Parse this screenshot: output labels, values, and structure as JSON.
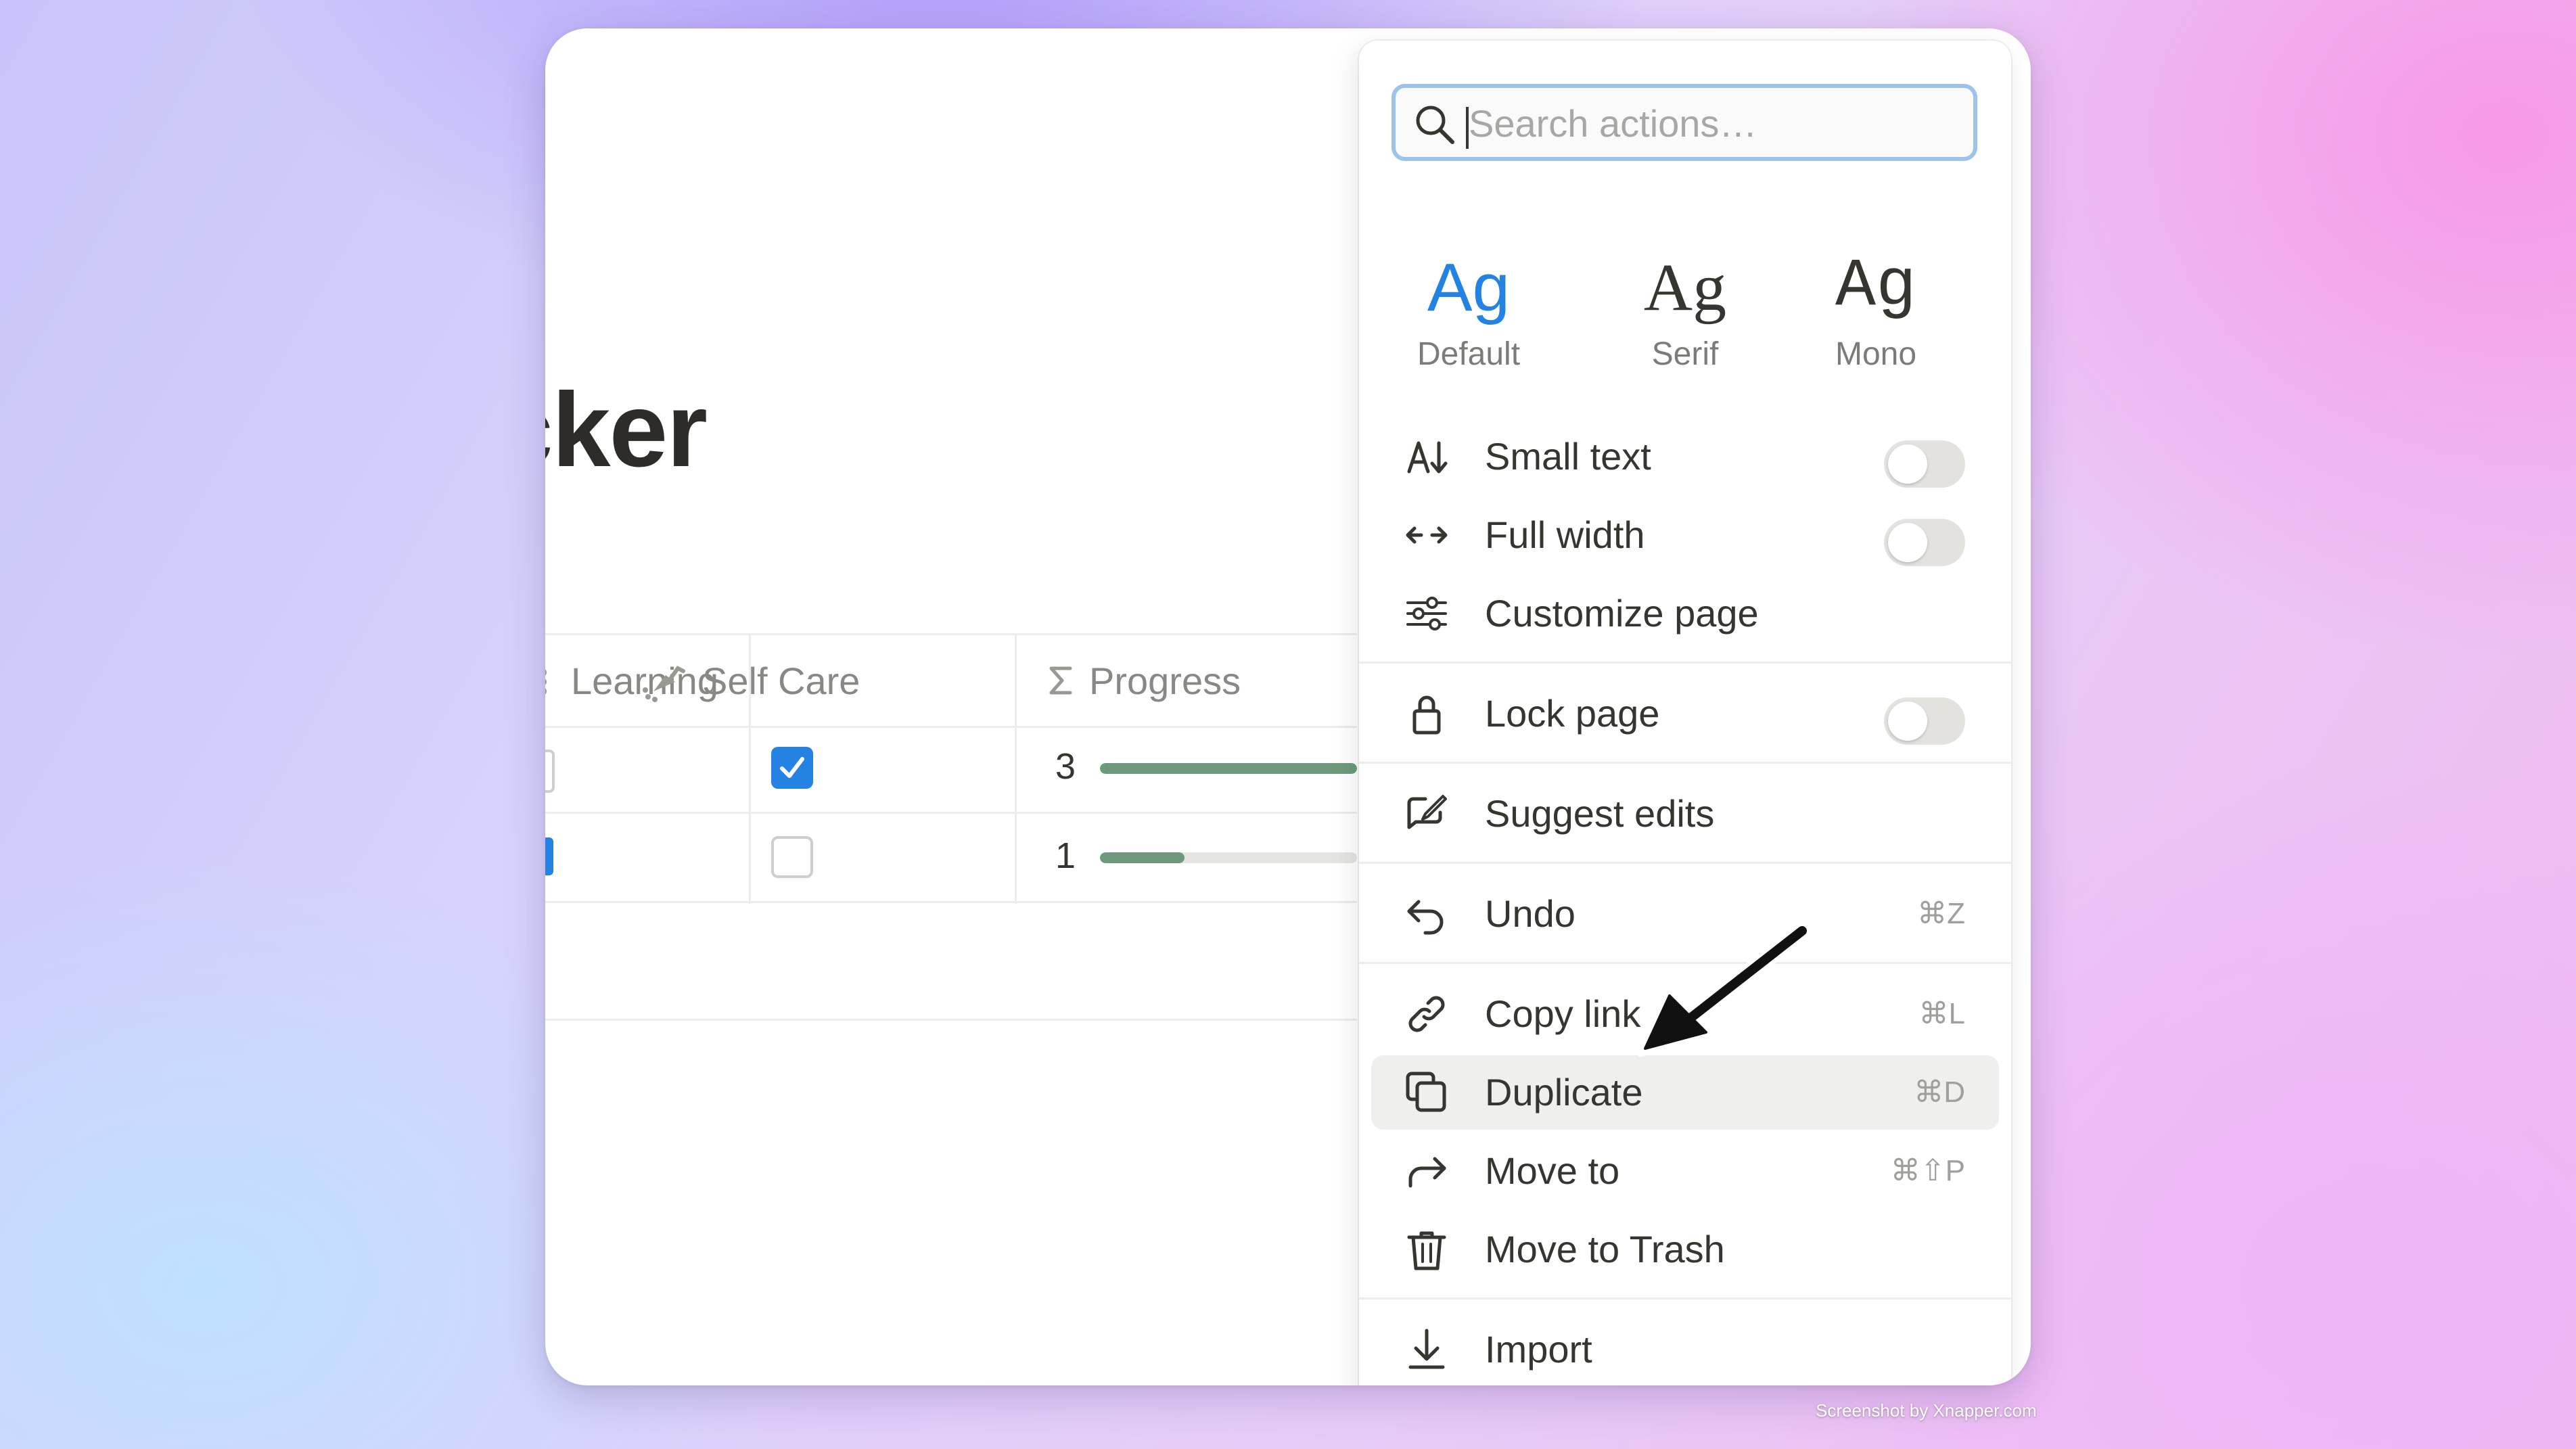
{
  "page": {
    "title": "cker",
    "table": {
      "columns": [
        {
          "label": "Learning",
          "icon": "list-icon"
        },
        {
          "label": "Self Care",
          "icon": "shower-icon"
        },
        {
          "label": "Progress",
          "icon": "sigma-icon"
        }
      ],
      "rows": [
        {
          "learning_checked": false,
          "self_care_checked": true,
          "progress_value": "3",
          "progress_fraction": 1.0
        },
        {
          "learning_checked": true,
          "self_care_checked": false,
          "progress_value": "1",
          "progress_fraction": 0.33
        }
      ]
    }
  },
  "menu": {
    "search": {
      "placeholder": "Search actions…"
    },
    "fonts": [
      {
        "sample": "Ag",
        "label": "Default",
        "active": true
      },
      {
        "sample": "Ag",
        "label": "Serif",
        "active": false
      },
      {
        "sample": "Ag",
        "label": "Mono",
        "active": false
      }
    ],
    "items": {
      "small_text": {
        "label": "Small text",
        "icon": "text-size-icon",
        "toggle_on": false
      },
      "full_width": {
        "label": "Full width",
        "icon": "arrows-horizontal-icon",
        "toggle_on": false
      },
      "customize_page": {
        "label": "Customize page",
        "icon": "sliders-icon"
      },
      "lock_page": {
        "label": "Lock page",
        "icon": "lock-icon",
        "toggle_on": false
      },
      "suggest_edits": {
        "label": "Suggest edits",
        "icon": "suggest-edit-icon"
      },
      "undo": {
        "label": "Undo",
        "icon": "undo-icon",
        "shortcut": "⌘Z"
      },
      "copy_link": {
        "label": "Copy link",
        "icon": "link-icon",
        "shortcut": "⌘L"
      },
      "duplicate": {
        "label": "Duplicate",
        "icon": "duplicate-icon",
        "shortcut": "⌘D"
      },
      "move_to": {
        "label": "Move to",
        "icon": "move-arrow-icon",
        "shortcut": "⌘⇧P"
      },
      "move_to_trash": {
        "label": "Move to Trash",
        "icon": "trash-icon"
      },
      "import": {
        "label": "Import",
        "icon": "import-icon"
      }
    }
  },
  "annotation": {
    "icon": "pointer-arrow-icon",
    "color": "#111111"
  },
  "watermark": {
    "text": "Screenshot by Xnapper.com"
  },
  "colors": {
    "accent": "#2483e2",
    "progress": "#6e9a7b",
    "search_focus": "#9cc3ec",
    "text": "#37352f",
    "muted": "#a19f9b"
  }
}
